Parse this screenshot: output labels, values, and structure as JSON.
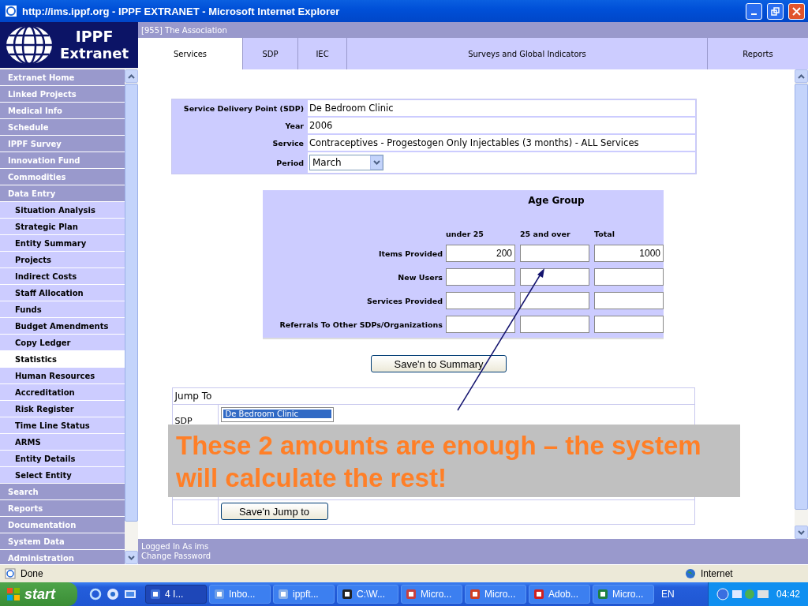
{
  "window": {
    "title": "http://ims.ippf.org - IPPF EXTRANET - Microsoft Internet Explorer"
  },
  "logo": {
    "line1": "IPPF",
    "line2": "Extranet"
  },
  "header_path": "[955] The Association",
  "tabs": [
    {
      "label": "Services",
      "selected": true
    },
    {
      "label": "SDP",
      "selected": false
    },
    {
      "label": "IEC",
      "selected": false
    },
    {
      "label": "Surveys and Global Indicators",
      "selected": false
    },
    {
      "label": "Reports",
      "selected": false
    }
  ],
  "sidebar": {
    "items": [
      {
        "label": "Extranet Home",
        "kind": "section",
        "selected": false
      },
      {
        "label": "Linked Projects",
        "kind": "section",
        "selected": false
      },
      {
        "label": "Medical Info",
        "kind": "section",
        "selected": false
      },
      {
        "label": "Schedule",
        "kind": "section",
        "selected": false
      },
      {
        "label": "IPPF Survey",
        "kind": "section",
        "selected": false
      },
      {
        "label": "Innovation Fund",
        "kind": "section",
        "selected": false
      },
      {
        "label": "Commodities",
        "kind": "section",
        "selected": false
      },
      {
        "label": "Data Entry",
        "kind": "section",
        "selected": false
      },
      {
        "label": "Situation Analysis",
        "kind": "sub",
        "selected": false
      },
      {
        "label": "Strategic Plan",
        "kind": "sub",
        "selected": false
      },
      {
        "label": "Entity Summary",
        "kind": "sub",
        "selected": false
      },
      {
        "label": "Projects",
        "kind": "sub",
        "selected": false
      },
      {
        "label": "Indirect Costs",
        "kind": "sub",
        "selected": false
      },
      {
        "label": "Staff Allocation",
        "kind": "sub",
        "selected": false
      },
      {
        "label": "Funds",
        "kind": "sub",
        "selected": false
      },
      {
        "label": "Budget Amendments",
        "kind": "sub",
        "selected": false
      },
      {
        "label": "Copy Ledger",
        "kind": "sub",
        "selected": false
      },
      {
        "label": "Statistics",
        "kind": "sub",
        "selected": true
      },
      {
        "label": "Human Resources",
        "kind": "sub",
        "selected": false
      },
      {
        "label": "Accreditation",
        "kind": "sub",
        "selected": false
      },
      {
        "label": "Risk Register",
        "kind": "sub",
        "selected": false
      },
      {
        "label": "Time Line Status",
        "kind": "sub",
        "selected": false
      },
      {
        "label": "ARMS",
        "kind": "sub",
        "selected": false
      },
      {
        "label": "Entity Details",
        "kind": "sub",
        "selected": false
      },
      {
        "label": "Select Entity",
        "kind": "sub",
        "selected": false
      },
      {
        "label": "Search",
        "kind": "section",
        "selected": false
      },
      {
        "label": "Reports",
        "kind": "section",
        "selected": false
      },
      {
        "label": "Documentation",
        "kind": "section",
        "selected": false
      },
      {
        "label": "System Data",
        "kind": "section",
        "selected": false
      },
      {
        "label": "Administration",
        "kind": "section",
        "selected": false
      }
    ]
  },
  "form": {
    "fields": [
      {
        "label": "Service Delivery Point (SDP)",
        "value": "De Bedroom Clinic",
        "kind": "text"
      },
      {
        "label": "Year",
        "value": "2006",
        "kind": "text"
      },
      {
        "label": "Service",
        "value": "Contraceptives - Progestogen Only Injectables (3 months) - ALL Services",
        "kind": "text"
      },
      {
        "label": "Period",
        "value": "March",
        "kind": "dropdown"
      }
    ]
  },
  "age_group": {
    "title": "Age Group",
    "columns": [
      "under 25",
      "25 and over",
      "Total"
    ],
    "rows": [
      {
        "label": "Items Provided",
        "cells": [
          {
            "value": "200"
          },
          {},
          {
            "value": "1000"
          }
        ]
      },
      {
        "label": "New Users",
        "cells": [
          {},
          {},
          {}
        ]
      },
      {
        "label": "Services Provided",
        "cells": [
          {},
          {},
          {}
        ]
      },
      {
        "label": "Referrals To Other SDPs/Organizations",
        "cells": [
          {},
          {},
          {}
        ]
      }
    ]
  },
  "save_summary_button": "Save'n to Summary",
  "jump_to": {
    "title": "Jump To",
    "sdp_label": "SDP",
    "list_items": [
      {
        "label": "De Bedroom Clinic",
        "selected": true
      }
    ],
    "button": "Save'n Jump to"
  },
  "annotation": {
    "text": "These 2 amounts are enough – the system will calculate the rest!"
  },
  "footer": [
    "Logged In As ims",
    "Change Password"
  ],
  "status_bar": {
    "text": "Done",
    "zone": "Internet"
  },
  "taskbar": {
    "start": "start",
    "items": [
      {
        "label": "4 I...",
        "selected": true
      },
      {
        "label": "Inbo...",
        "selected": false
      },
      {
        "label": "ippft...",
        "selected": false
      },
      {
        "label": "C:\\W...",
        "selected": false
      },
      {
        "label": "Micro...",
        "selected": false
      },
      {
        "label": "Micro...",
        "selected": false
      },
      {
        "label": "Adob...",
        "selected": false
      },
      {
        "label": "Micro...",
        "selected": false
      }
    ],
    "language": "EN",
    "clock": "04:42"
  }
}
